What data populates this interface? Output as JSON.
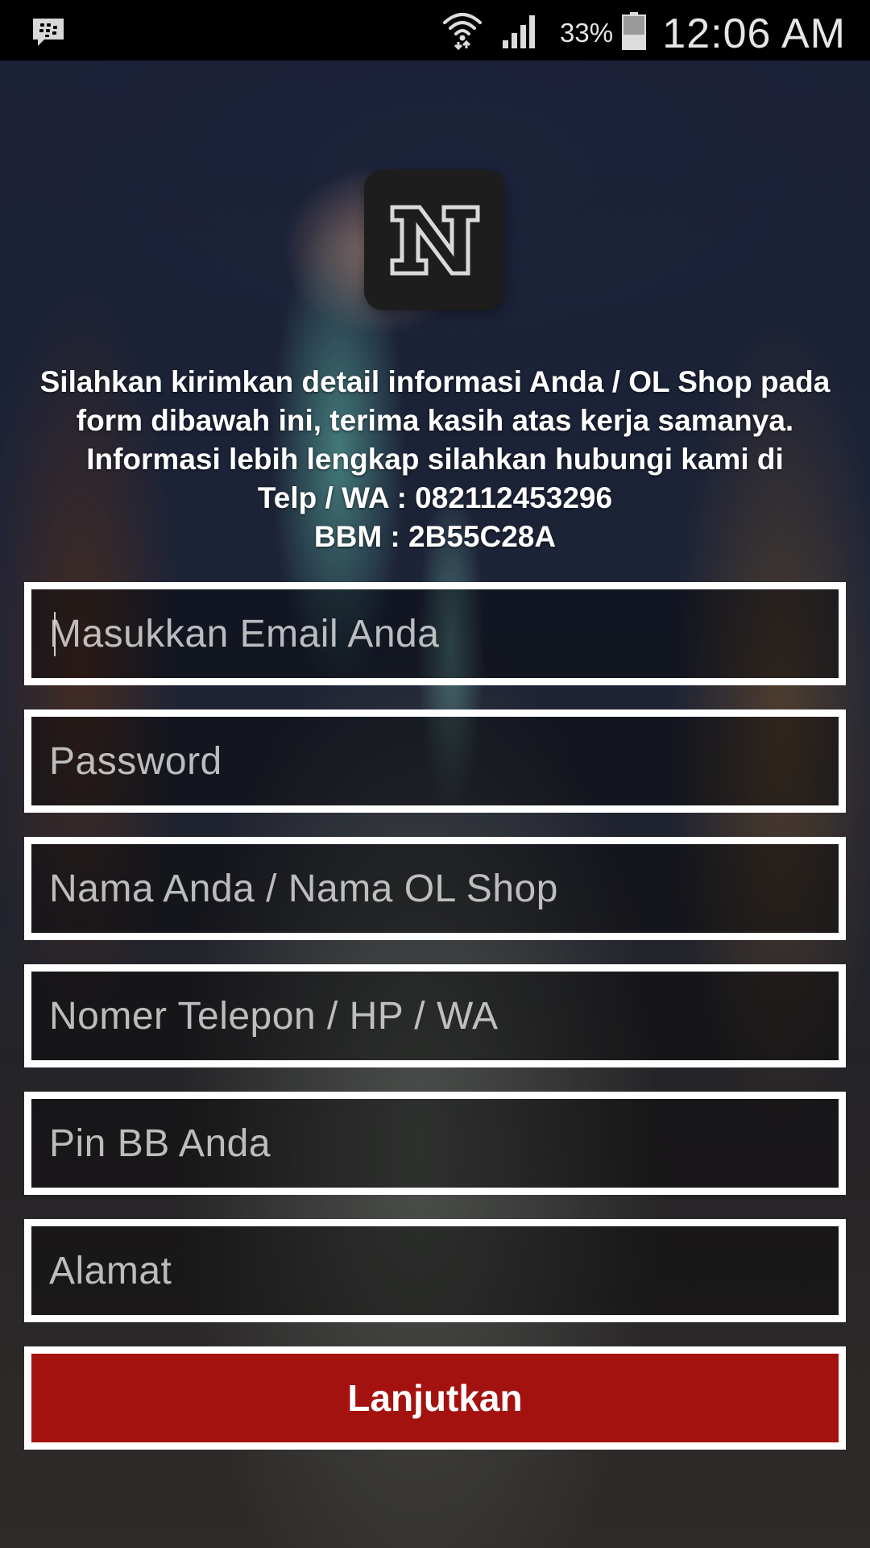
{
  "status_bar": {
    "notification_icon": "bbm-chat-icon",
    "wifi_icon": "wifi-icon",
    "signal_icon": "cell-signal-icon",
    "battery_percent": "33%",
    "battery_icon": "battery-icon",
    "time": "12:06 AM"
  },
  "logo": {
    "icon": "n-logo-icon"
  },
  "info_lines": [
    "Silahkan kirimkan detail informasi Anda / OL Shop pada",
    "form dibawah ini, terima kasih atas kerja samanya.",
    "Informasi lebih lengkap silahkan hubungi kami di",
    "Telp / WA : 082112453296",
    "BBM : 2B55C28A"
  ],
  "form": {
    "email": {
      "placeholder": "Masukkan Email Anda",
      "value": ""
    },
    "password": {
      "placeholder": "Password",
      "value": ""
    },
    "name": {
      "placeholder": "Nama Anda / Nama OL Shop",
      "value": ""
    },
    "phone": {
      "placeholder": "Nomer Telepon / HP / WA",
      "value": ""
    },
    "pin_bb": {
      "placeholder": "Pin BB Anda",
      "value": ""
    },
    "address": {
      "placeholder": "Alamat",
      "value": ""
    },
    "submit_label": "Lanjutkan"
  },
  "colors": {
    "button_bg": "#a4120f",
    "field_border": "#ffffff",
    "status_bar_bg": "#000000",
    "logo_bg": "#1d1d1d"
  }
}
